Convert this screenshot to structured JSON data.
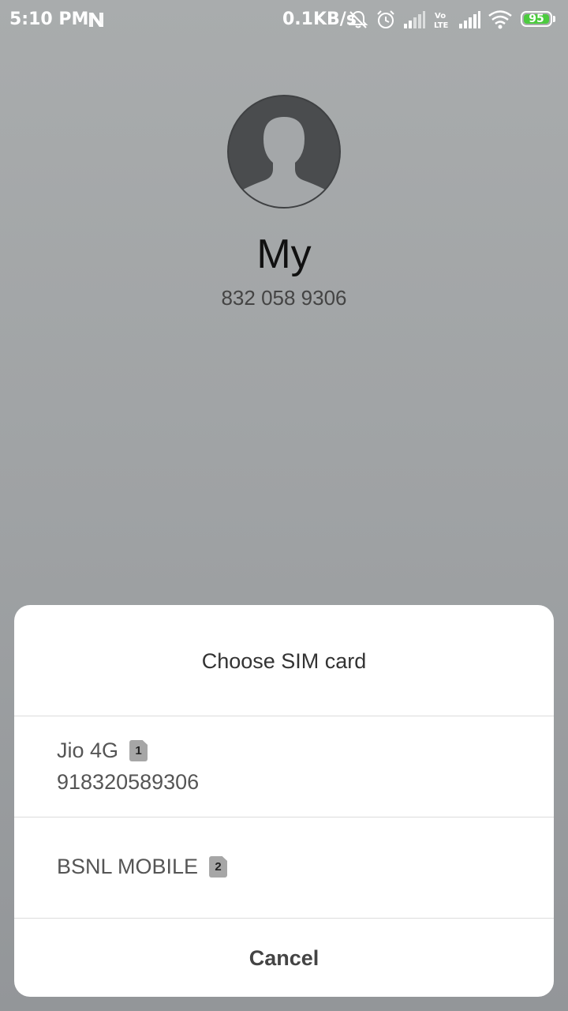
{
  "status_bar": {
    "time": "5:10 PM",
    "net_speed": "0.1KB/s",
    "battery_level": "95",
    "icons": [
      "n-notification-icon",
      "bell-off-icon",
      "alarm-icon",
      "signal-icon",
      "volte-icon",
      "signal-icon",
      "wifi-icon",
      "battery-icon"
    ]
  },
  "contact": {
    "name": "My",
    "number": "832 058 9306",
    "avatar": "avatar-placeholder-icon"
  },
  "dialog": {
    "title": "Choose SIM card",
    "options": [
      {
        "name": "Jio 4G",
        "badge": "1",
        "number": "918320589306"
      },
      {
        "name": "BSNL MOBILE",
        "badge": "2",
        "number": ""
      }
    ],
    "cancel_label": "Cancel"
  },
  "colors": {
    "background_top": "#a9acad",
    "background_bottom": "#939699",
    "battery_green": "#4ccb3f",
    "dialog_bg": "#ffffff",
    "sim_badge": "#a6a6a6"
  }
}
